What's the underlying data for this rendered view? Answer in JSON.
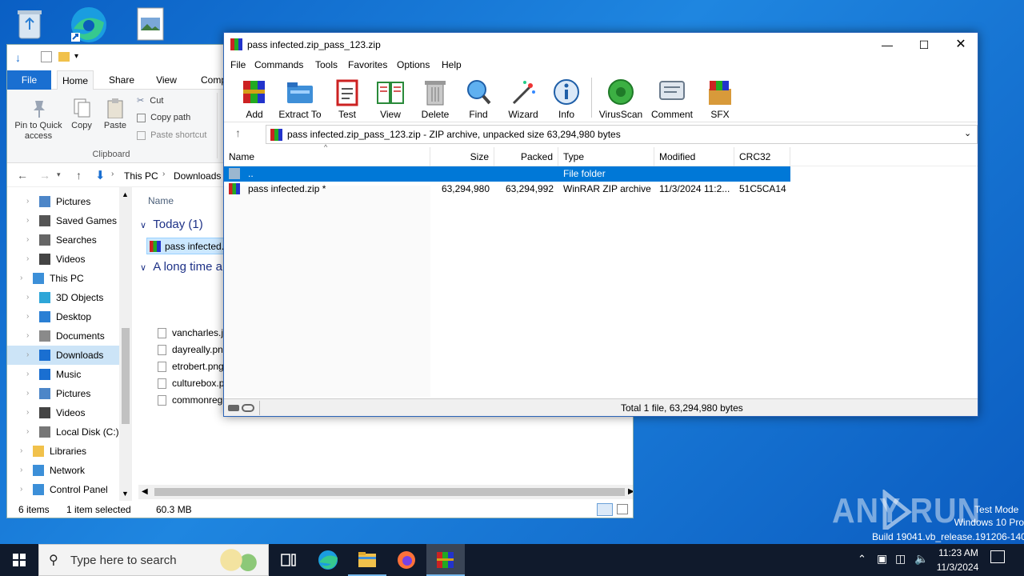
{
  "desktop": {
    "watermark": {
      "brand": "ANY RUN",
      "line1": "Test Mode",
      "line2": "Windows 10 Pro",
      "line3": "Build 19041.vb_release.191206-1406"
    }
  },
  "explorer": {
    "tabs": [
      "File",
      "Home",
      "Share",
      "View",
      "Comp"
    ],
    "ribbon": {
      "pin_label": "Pin to Quick access",
      "copy_label": "Copy",
      "paste_label": "Paste",
      "cut_label": "Cut",
      "copy_path_label": "Copy path",
      "paste_shortcut_label": "Paste shortcut",
      "group_label": "Clipboard"
    },
    "breadcrumb": {
      "part1": "This PC",
      "part2": "Downloads"
    },
    "nav_items": [
      {
        "label": "Pictures",
        "icon": "pictures-icon",
        "indent": 1
      },
      {
        "label": "Saved Games",
        "icon": "saved-games-icon",
        "indent": 1
      },
      {
        "label": "Searches",
        "icon": "search-icon",
        "indent": 1
      },
      {
        "label": "Videos",
        "icon": "videos-icon",
        "indent": 1
      },
      {
        "label": "This PC",
        "icon": "this-pc-icon",
        "indent": 0
      },
      {
        "label": "3D Objects",
        "icon": "3d-objects-icon",
        "indent": 1
      },
      {
        "label": "Desktop",
        "icon": "desktop-icon",
        "indent": 1
      },
      {
        "label": "Documents",
        "icon": "documents-icon",
        "indent": 1
      },
      {
        "label": "Downloads",
        "icon": "downloads-icon",
        "indent": 1,
        "selected": true
      },
      {
        "label": "Music",
        "icon": "music-icon",
        "indent": 1
      },
      {
        "label": "Pictures",
        "icon": "pictures-icon",
        "indent": 1
      },
      {
        "label": "Videos",
        "icon": "videos-icon",
        "indent": 1
      },
      {
        "label": "Local Disk (C:)",
        "icon": "drive-icon",
        "indent": 1
      },
      {
        "label": "Libraries",
        "icon": "libraries-icon",
        "indent": 0
      },
      {
        "label": "Network",
        "icon": "network-icon",
        "indent": 0
      },
      {
        "label": "Control Panel",
        "icon": "control-panel-icon",
        "indent": 0
      }
    ],
    "column_name": "Name",
    "group_today": "Today (1)",
    "today_file": "pass infected.",
    "group_long": "A long time a",
    "old_files": [
      "vancharles.jpg",
      "dayreally.png",
      "etrobert.png",
      "culturebox.pn",
      "commonregis"
    ],
    "status": {
      "items": "6 items",
      "selected": "1 item selected",
      "size": "60.3 MB"
    }
  },
  "winrar": {
    "title": "pass infected.zip_pass_123.zip",
    "menu": [
      "File",
      "Commands",
      "Tools",
      "Favorites",
      "Options",
      "Help"
    ],
    "toolbar": [
      {
        "label": "Add",
        "icon": "add-archive-icon"
      },
      {
        "label": "Extract To",
        "icon": "extract-folder-icon"
      },
      {
        "label": "Test",
        "icon": "test-clipboard-icon"
      },
      {
        "label": "View",
        "icon": "view-book-icon"
      },
      {
        "label": "Delete",
        "icon": "trash-icon"
      },
      {
        "label": "Find",
        "icon": "magnifier-icon"
      },
      {
        "label": "Wizard",
        "icon": "wizard-wand-icon"
      },
      {
        "label": "Info",
        "icon": "info-icon"
      },
      {
        "label": "VirusScan",
        "icon": "virus-scan-icon"
      },
      {
        "label": "Comment",
        "icon": "comment-icon"
      },
      {
        "label": "SFX",
        "icon": "sfx-box-icon"
      }
    ],
    "address": "pass infected.zip_pass_123.zip - ZIP archive, unpacked size 63,294,980 bytes",
    "columns": [
      "Name",
      "Size",
      "Packed",
      "Type",
      "Modified",
      "CRC32"
    ],
    "rows": [
      {
        "name": "..",
        "size": "",
        "packed": "",
        "type": "File folder",
        "modified": "",
        "crc": ""
      },
      {
        "name": "pass infected.zip *",
        "size": "63,294,980",
        "packed": "63,294,992",
        "type": "WinRAR ZIP archive",
        "modified": "11/3/2024 11:2...",
        "crc": "51C5CA14"
      }
    ],
    "status": "Total 1 file, 63,294,980 bytes"
  },
  "taskbar": {
    "search_placeholder": "Type here to search",
    "time": "11:23 AM",
    "date": "11/3/2024"
  },
  "colors": {
    "accent": "#0078d7",
    "selection": "#0078d7",
    "taskbar": "#101a2c"
  }
}
